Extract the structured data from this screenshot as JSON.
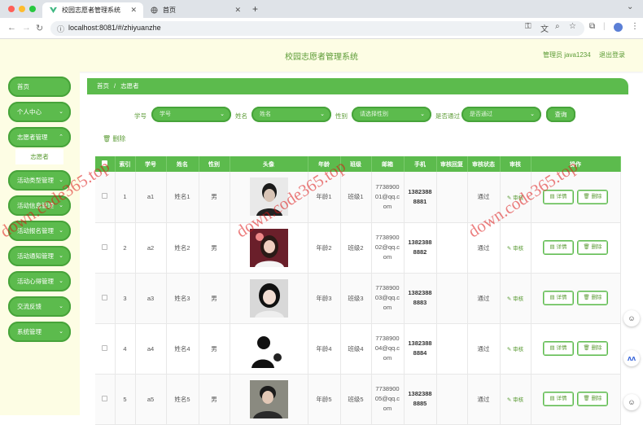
{
  "browser": {
    "tabs": [
      {
        "title": "校园志愿者管理系统"
      },
      {
        "title": "首页"
      }
    ],
    "new_tab": "+",
    "url": "localhost:8081/#/zhiyuanzhe"
  },
  "header": {
    "title": "校园志愿者管理系统",
    "user": "管理员 java1234",
    "logout": "退出登录"
  },
  "sidebar": {
    "items": [
      {
        "label": "首页"
      },
      {
        "label": "个人中心"
      },
      {
        "label": "志愿者管理"
      },
      {
        "label": "活动类型管理"
      },
      {
        "label": "活动信息管理"
      },
      {
        "label": "活动报名管理"
      },
      {
        "label": "活动通知管理"
      },
      {
        "label": "活动心得管理"
      },
      {
        "label": "交流反馈"
      },
      {
        "label": "系统管理"
      }
    ],
    "sub_item": "志愿者"
  },
  "breadcrumb": {
    "home": "首页",
    "sep": "/",
    "current": "志愿者"
  },
  "filters": {
    "xuehao_label": "学号",
    "xuehao_placeholder": "学号",
    "xingming_label": "姓名",
    "xingming_placeholder": "姓名",
    "xingbie_label": "性别",
    "xingbie_placeholder": "请选择性别",
    "shenhe_label": "是否通过",
    "shenhe_placeholder": "是否通过",
    "search_button": "查询"
  },
  "delete_button": "删除",
  "table": {
    "headers": [
      "",
      "索引",
      "学号",
      "姓名",
      "性别",
      "头像",
      "年龄",
      "班级",
      "邮箱",
      "手机",
      "审核回复",
      "审核状态",
      "审核",
      "操作"
    ],
    "rows": [
      {
        "index": "1",
        "xuehao": "a1",
        "name": "姓名1",
        "gender": "男",
        "age": "年龄1",
        "class": "班级1",
        "email": "7738900 01@qq.c om",
        "phone": "1382388 8881",
        "reply": "",
        "status": "通过",
        "audit": "审核",
        "detail": "详情",
        "del": "删除"
      },
      {
        "index": "2",
        "xuehao": "a2",
        "name": "姓名2",
        "gender": "男",
        "age": "年龄2",
        "class": "班级2",
        "email": "7738900 02@qq.c om",
        "phone": "1382388 8882",
        "reply": "",
        "status": "通过",
        "audit": "审核",
        "detail": "详情",
        "del": "删除"
      },
      {
        "index": "3",
        "xuehao": "a3",
        "name": "姓名3",
        "gender": "男",
        "age": "年龄3",
        "class": "班级3",
        "email": "7738900 03@qq.c om",
        "phone": "1382388 8883",
        "reply": "",
        "status": "通过",
        "audit": "审核",
        "detail": "详情",
        "del": "删除"
      },
      {
        "index": "4",
        "xuehao": "a4",
        "name": "姓名4",
        "gender": "男",
        "age": "年龄4",
        "class": "班级4",
        "email": "7738900 04@qq.c om",
        "phone": "1382388 8884",
        "reply": "",
        "status": "通过",
        "audit": "审核",
        "detail": "详情",
        "del": "删除"
      },
      {
        "index": "5",
        "xuehao": "a5",
        "name": "姓名5",
        "gender": "男",
        "age": "年龄5",
        "class": "班级5",
        "email": "7738900 05@qq.c om",
        "phone": "1382388 8885",
        "reply": "",
        "status": "通过",
        "audit": "审核",
        "detail": "详情",
        "del": "删除"
      }
    ]
  },
  "watermark": "down.code365.top",
  "colors": {
    "accent": "#5cbb4d",
    "header_bg": "#fdfde4",
    "text_green": "#5b9b35"
  }
}
